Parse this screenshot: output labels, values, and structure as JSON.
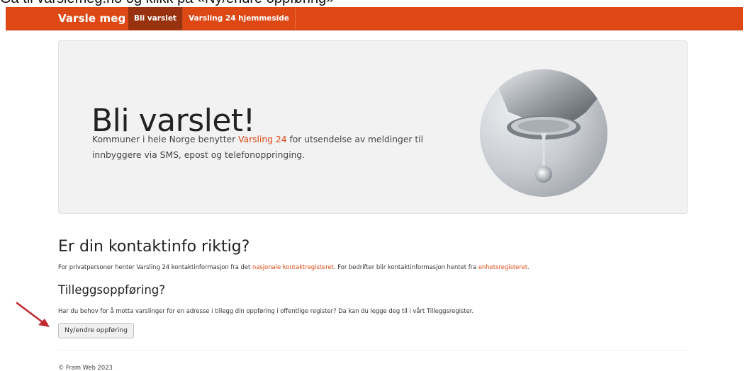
{
  "caption": "Gå til varslemeg.no og klikk på «Ny/endre oppføring»",
  "navbar": {
    "brand": "Varsle meg",
    "tabs": [
      {
        "label": "Bli varslet",
        "active": true
      },
      {
        "label": "Varsling 24 hjemmeside",
        "active": false
      }
    ],
    "bg_color": "#dd4814"
  },
  "jumbotron": {
    "title": "Bli varslet!",
    "text_before": "Kommuner i hele Norge benytter ",
    "link": "Varsling 24",
    "text_after": " for utsendelse av meldinger til innbyggere via SMS, epost og telefonoppringing."
  },
  "contact": {
    "title": "Er din kontaktinfo riktig?",
    "text_1": "For privatpersoner henter Varsling 24 kontaktinformasjon fra det ",
    "link_1": "nasjonale kontaktregisteret",
    "text_2": ". For bedrifter blir kontaktinformasjon hentet fra ",
    "link_2": "enhetsregisteret",
    "text_3": "."
  },
  "supplement": {
    "title": "Tilleggsoppføring?",
    "text": "Har du behov for å motta varslinger for en adresse i tillegg din oppføring i offentlige register? Da kan du legge deg til i vårt Tilleggsregister.",
    "button": "Ny/endre oppføring"
  },
  "footer": "© Fram Web 2023",
  "annotation_color": "#c0282d"
}
